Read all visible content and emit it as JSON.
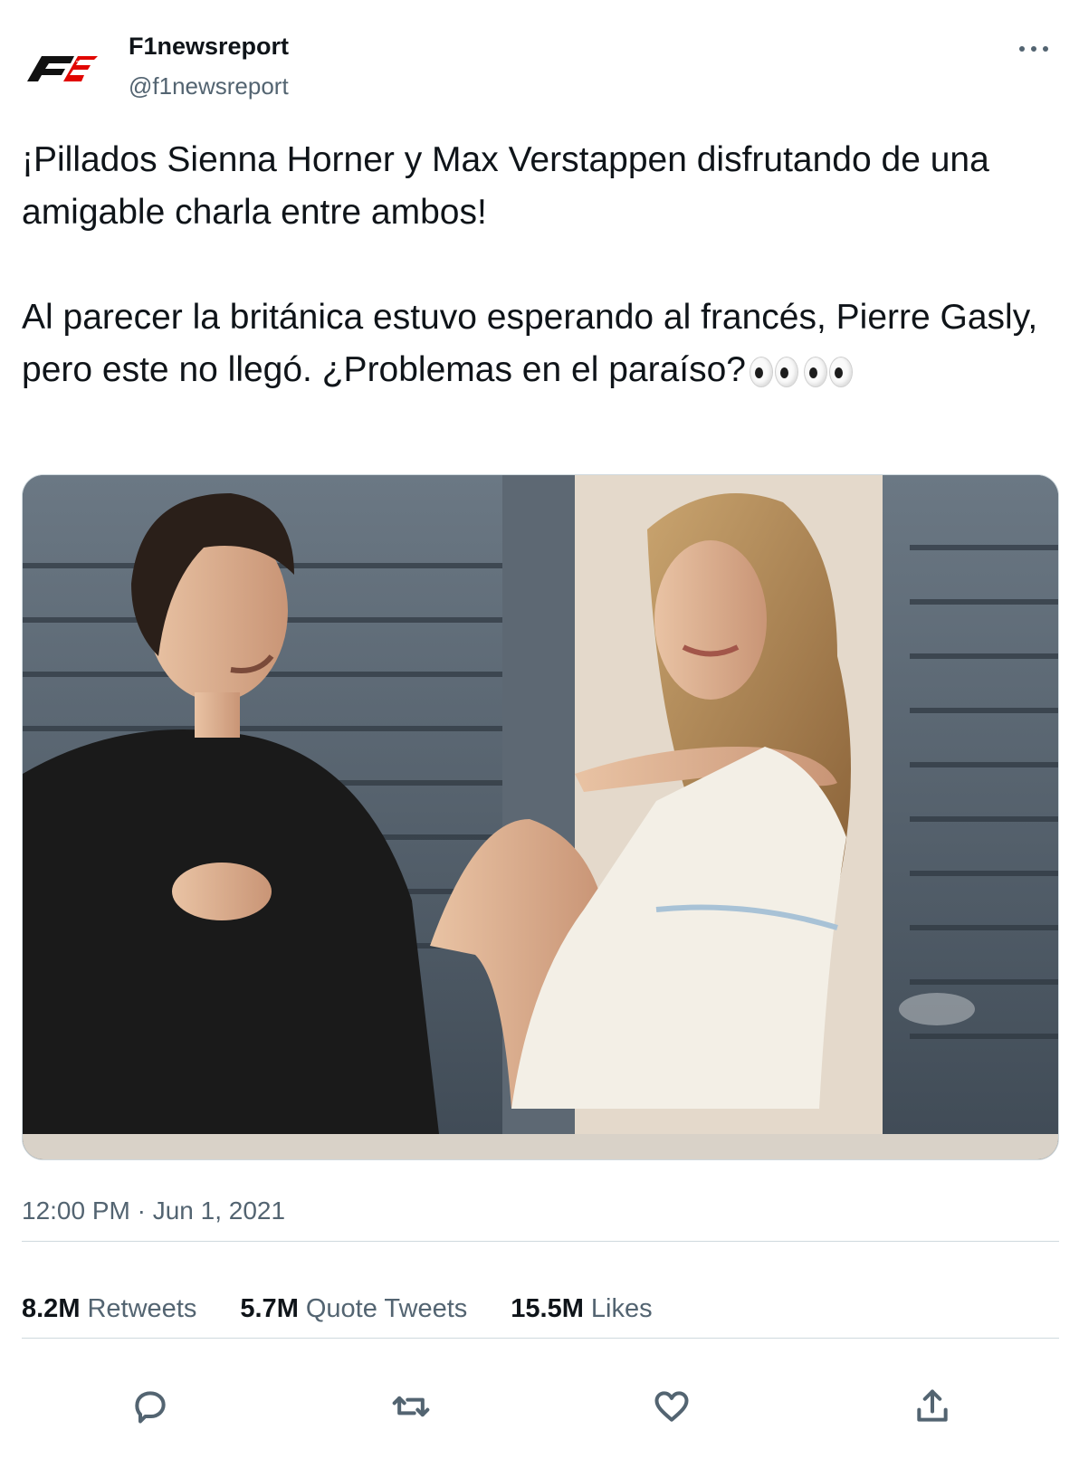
{
  "author": {
    "display_name": "F1newsreport",
    "handle": "@f1newsreport",
    "avatar_icon": "f1-logo-icon"
  },
  "tweet": {
    "text_paragraph_1": "¡Pillados Sienna Horner y Max Verstappen disfrutando de una amigable charla entre ambos!",
    "text_paragraph_2": "Al parecer la británica estuvo esperando al francés, Pierre Gasly, pero este no llegó. ¿Problemas en el paraíso?",
    "emoji": [
      "eyes-emoji",
      "eyes-emoji"
    ],
    "timestamp": "12:00 PM · Jun 1, 2021"
  },
  "stats": [
    {
      "value": "8.2M",
      "label": "Retweets"
    },
    {
      "value": "5.7M",
      "label": "Quote Tweets"
    },
    {
      "value": "15.5M",
      "label": "Likes"
    }
  ],
  "actions": [
    "reply-icon",
    "retweet-icon",
    "like-icon",
    "share-icon"
  ],
  "colors": {
    "text_primary": "#0f1419",
    "text_secondary": "#536471",
    "divider": "#cfd9de",
    "f1_red": "#e10600"
  }
}
